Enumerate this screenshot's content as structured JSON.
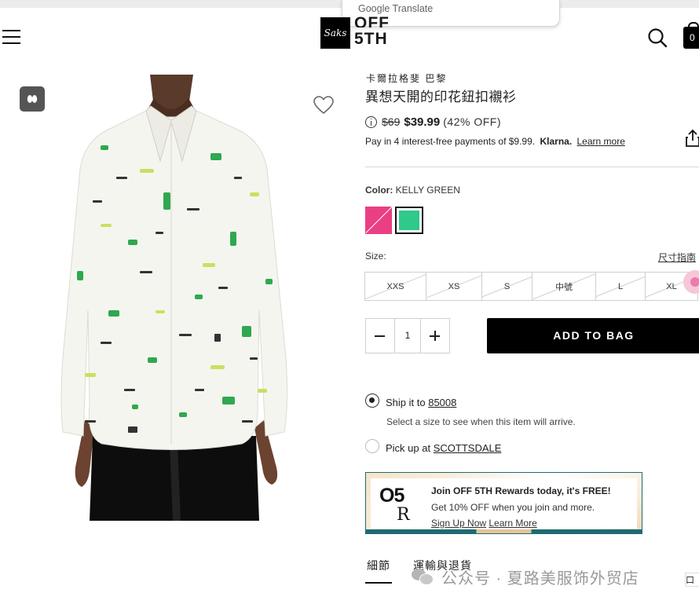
{
  "translate_popup": {
    "label": "Google Translate"
  },
  "header": {
    "logo_saks": "Saks",
    "logo_off": "OFF",
    "logo_fifth": "5TH",
    "bag_count": "0"
  },
  "product": {
    "brand": "卡爾拉格斐 巴黎",
    "title": "異想天開的印花鈕扣襯衫",
    "old_price": "$69",
    "new_price": "$39.99",
    "discount": "(42% OFF)",
    "klarna_text": "Pay in 4 interest-free payments of $9.99.",
    "klarna_brand": "Klarna.",
    "klarna_learn": "Learn more",
    "color_label": "Color:",
    "color_value": "KELLY GREEN",
    "colors": [
      "#ea3f83",
      "#2fc98a"
    ],
    "size_label": "Size:",
    "size_guide": "尺寸指南",
    "sizes": [
      "XXS",
      "XS",
      "S",
      "中號",
      "L",
      "XL"
    ],
    "quantity": "1",
    "add_to_bag": "ADD TO BAG"
  },
  "fulfillment": {
    "ship_prefix": "Ship it to",
    "ship_zip": "85008",
    "ship_note": "Select a size to see when this item will arrive.",
    "pickup_prefix": "Pick up at",
    "pickup_store": "SCOTTSDALE"
  },
  "rewards": {
    "logo_top": "O5",
    "logo_bottom": "R",
    "title": "Join OFF 5TH Rewards today, it's FREE!",
    "subtitle": "Get 10% OFF when you join and more.",
    "sign_up": "Sign Up Now",
    "learn_more": "Learn More"
  },
  "tabs": {
    "details": "細節",
    "shipping": "運輸與退貨"
  },
  "watermark": {
    "text": "公众号 · 夏路美服饰外贸店"
  },
  "side_fragment": {
    "text": "口"
  },
  "accent_colors": {
    "brand_black": "#000000",
    "rewards_teal": "#1d6b73",
    "swatch_pink": "#ea3f83",
    "swatch_green": "#2fc98a"
  }
}
